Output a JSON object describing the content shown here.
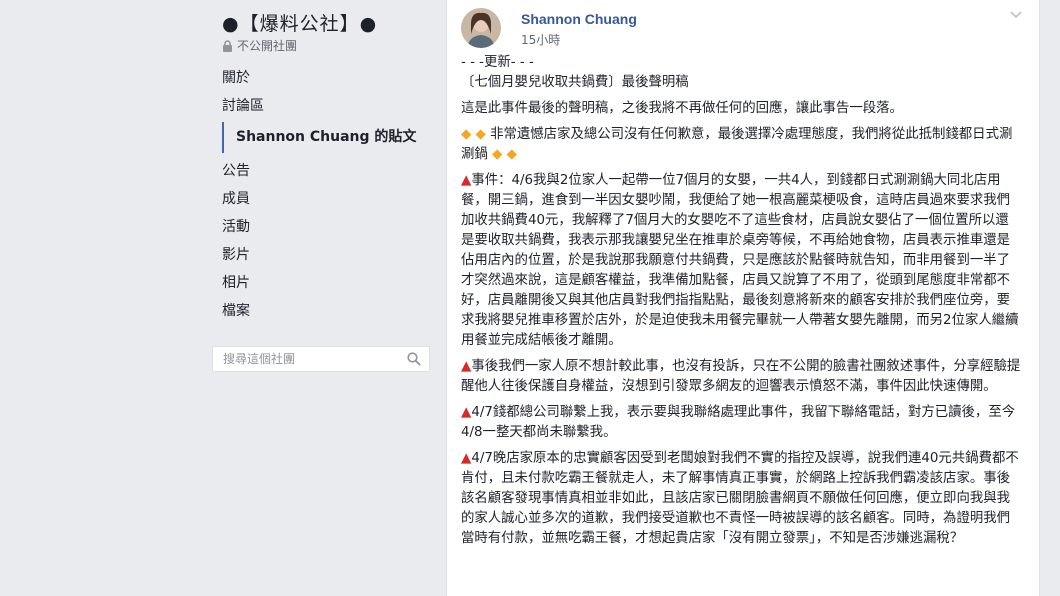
{
  "group": {
    "name": "●【爆料公社】●",
    "privacy": "不公開社團"
  },
  "nav": {
    "items": [
      "關於",
      "討論區",
      "Shannon Chuang 的貼文",
      "公告",
      "成員",
      "活動",
      "影片",
      "相片",
      "檔案"
    ],
    "active_index": 2
  },
  "search": {
    "placeholder": "搜尋這個社團"
  },
  "post": {
    "author": "Shannon Chuang",
    "timestamp": "15小時",
    "update_tag": "- - -更新- - -",
    "title": "〔七個月嬰兒收取共鍋費〕最後聲明稿",
    "statement": "這是此事件最後的聲明稿，之後我將不再做任何的回應，讓此事告一段落。",
    "boycott_text": "非常遺憾店家及總公司沒有任何歉意，最後選擇冷處理態度，我們將從此抵制錢都日式涮涮鍋",
    "event_text": "事件：4/6我與2位家人一起帶一位7個月的女嬰，一共4人，到錢都日式涮涮鍋大同北店用餐，開三鍋，進食到一半因女嬰吵鬧，我便給了她一根高麗菜梗吸食，這時店員過來要求我們加收共鍋費40元，我解釋了7個月大的女嬰吃不了這些食材，店員說女嬰佔了一個位置所以還是要收取共鍋費，我表示那我讓嬰兒坐在推車於桌旁等候，不再給她食物，店員表示推車還是佔用店內的位置，於是我說那我願意付共鍋費，只是應該於點餐時就告知，而非用餐到一半了才突然過來說，這是顧客權益，我準備加點餐，店員又說算了不用了，從頭到尾態度非常都不好，店員離開後又與其他店員對我們指指點點，最後刻意將新來的顧客安排於我們座位旁，要求我將嬰兒推車移置於店外，於是迫使我未用餐完畢就一人帶著女嬰先離開，而另2位家人繼續用餐並完成結帳後才離開。",
    "afterward_text": "事後我們一家人原不想計較此事，也沒有投訴，只在不公開的臉書社團敘述事件，分享經驗提醒他人往後保護自身權益，沒想到引發眾多網友的迴響表示憤怒不滿，事件因此快速傳開。",
    "contact_text": "4/7錢都總公司聯繫上我，表示要與我聯絡處理此事件，我留下聯絡電話，對方已讀後，至今4/8一整天都尚未聯繫我。",
    "accusation_text": "4/7晚店家原本的忠實顧客因受到老闆娘對我們不實的指控及誤導，說我們連40元共鍋費都不肯付，且未付款吃霸王餐就走人，未了解事情真正事實，於網路上控訴我們霸凌該店家。事後該名顧客發現事情真相並非如此，且該店家已關閉臉書網頁不願做任何回應，便立即向我與我的家人誠心並多次的道歉，我們接受道歉也不責怪一時被誤導的該名顧客。同時，為證明我們當時有付款，並無吃霸王餐，才想起貴店家「沒有開立發票」，不知是否涉嫌逃漏稅？"
  },
  "colors": {
    "background": "#e9ebee",
    "link": "#365899",
    "active_bar": "#4267b2",
    "warning_triangle": "#d52a2a",
    "diamond": "#f5a623"
  },
  "icons": [
    "lock-icon",
    "search-icon",
    "chevron-down-icon",
    "avatar",
    "orange-diamond-icon",
    "red-triangle-icon"
  ]
}
